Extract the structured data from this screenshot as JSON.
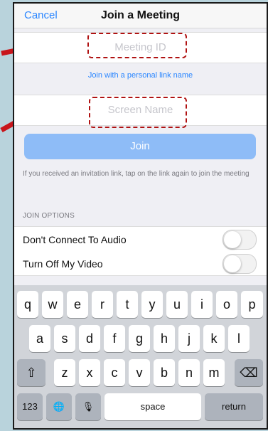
{
  "nav": {
    "cancel": "Cancel",
    "title": "Join a Meeting"
  },
  "form": {
    "meeting_id_placeholder": "Meeting ID",
    "personal_link": "Join with a personal link name",
    "screen_name_placeholder": "Screen Name",
    "join_label": "Join",
    "hint": "If you received an invitation link, tap on the link again to join the meeting"
  },
  "options": {
    "section_label": "JOIN OPTIONS",
    "items": [
      {
        "label": "Don't Connect To Audio",
        "on": false
      },
      {
        "label": "Turn Off My Video",
        "on": false
      }
    ]
  },
  "keyboard": {
    "row1": [
      "q",
      "w",
      "e",
      "r",
      "t",
      "y",
      "u",
      "i",
      "o",
      "p"
    ],
    "row2": [
      "a",
      "s",
      "d",
      "f",
      "g",
      "h",
      "j",
      "k",
      "l"
    ],
    "row3": [
      "z",
      "x",
      "c",
      "v",
      "b",
      "n",
      "m"
    ],
    "shift": "⇧",
    "delete": "⌫",
    "numbers": "123",
    "globe": "🌐",
    "mic": "🎙",
    "space": "space",
    "return": "return"
  },
  "colors": {
    "accent": "#2a86ff",
    "join_button": "#8ebcf7",
    "annotation": "#b01212",
    "backdrop": "#b9d3dc"
  }
}
